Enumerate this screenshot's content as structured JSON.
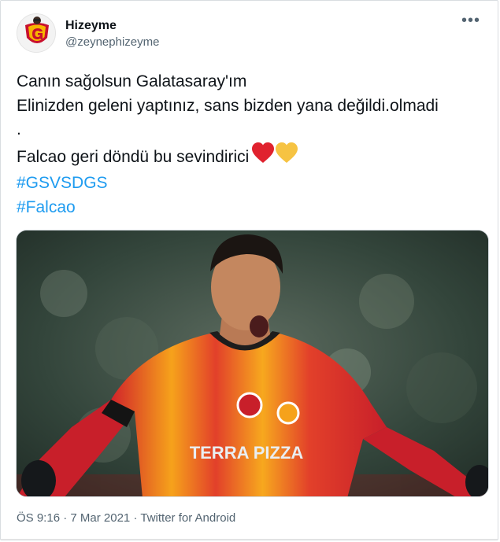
{
  "tweet": {
    "author": {
      "display_name": "Hizeyme",
      "handle": "@zeynephizeyme",
      "avatar_icon": "galatasaray-crest-avatar"
    },
    "more_icon": "more-options-icon",
    "lines": [
      "Canın sağolsun Galatasaray'ım",
      "Elinizden geleni yaptınız, sans bizden yana değildi.olmadi",
      ".",
      "Falcao geri döndü bu sevindirici"
    ],
    "emojis": [
      "red-heart-icon",
      "yellow-heart-icon"
    ],
    "hashtags": [
      "#GSVSDGS",
      "#Falcao"
    ],
    "media": {
      "description_icon": "photo-falcao-celebrating",
      "shirt_sponsor": "TERRA PIZZA"
    },
    "meta": {
      "time": "ÖS 9:16",
      "separator": "·",
      "date": "7 Mar 2021",
      "source": "Twitter for Android"
    },
    "colors": {
      "link": "#1d9bf0",
      "secondary_text": "#536471",
      "primary_text": "#0f1419",
      "heart_red": "#e0222e",
      "heart_yellow": "#f6c342"
    }
  }
}
